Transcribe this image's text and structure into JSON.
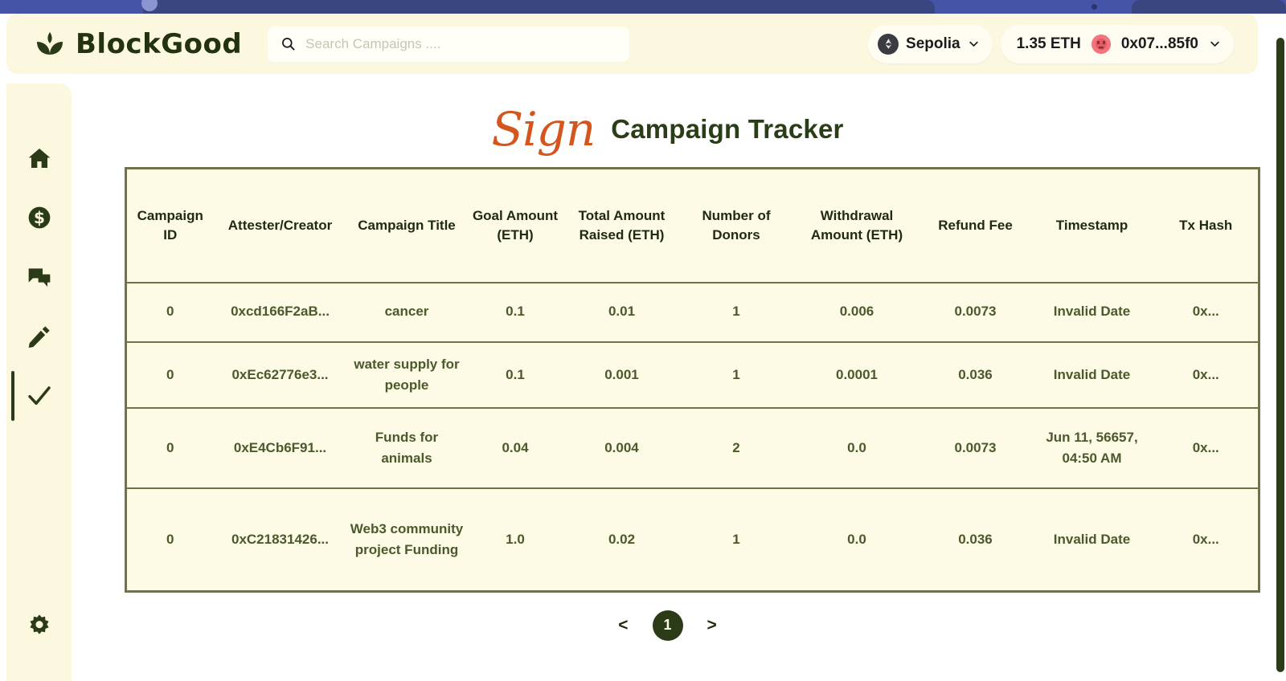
{
  "brand": {
    "name": "BlockGood",
    "logo_icon": "sprout-leaf-icon"
  },
  "search": {
    "placeholder": "Search Campaigns ....",
    "value": "",
    "icon": "search-icon"
  },
  "header": {
    "network": {
      "label": "Sepolia",
      "icon": "ethereum-icon",
      "chevron": "chevron-down-icon"
    },
    "wallet": {
      "balance": "1.35 ETH",
      "address": "0x07...85f0",
      "avatar_icon": "blockie-avatar-icon",
      "chevron": "chevron-down-icon"
    }
  },
  "sidebar": {
    "items": [
      {
        "name": "home",
        "icon": "home-icon",
        "active": false
      },
      {
        "name": "donations",
        "icon": "dollar-circle-icon",
        "active": false
      },
      {
        "name": "messages",
        "icon": "chat-bubbles-icon",
        "active": false
      },
      {
        "name": "create",
        "icon": "pencil-icon",
        "active": false
      },
      {
        "name": "verified",
        "icon": "check-icon",
        "active": true
      }
    ],
    "bottom_item": {
      "name": "settings",
      "icon": "gear-icon"
    }
  },
  "page": {
    "title_script": "Sign",
    "title": "Campaign Tracker"
  },
  "table": {
    "columns": [
      "Campaign ID",
      "Attester/Creator",
      "Campaign Title",
      "Goal Amount (ETH)",
      "Total Amount Raised (ETH)",
      "Number of Donors",
      "Withdrawal Amount (ETH)",
      "Refund Fee",
      "Timestamp",
      "Tx Hash"
    ],
    "rows": [
      {
        "campaign_id": "0",
        "attester": "0xcd166F2aB...",
        "title": "cancer",
        "goal_amount": "0.1",
        "total_raised": "0.01",
        "donors": "1",
        "withdrawal": "0.006",
        "refund_fee": "0.0073",
        "timestamp": "Invalid Date",
        "tx_hash": "0x..."
      },
      {
        "campaign_id": "0",
        "attester": "0xEc62776e3...",
        "title": "water supply for people",
        "goal_amount": "0.1",
        "total_raised": "0.001",
        "donors": "1",
        "withdrawal": "0.0001",
        "refund_fee": "0.036",
        "timestamp": "Invalid Date",
        "tx_hash": "0x..."
      },
      {
        "campaign_id": "0",
        "attester": "0xE4Cb6F91...",
        "title": "Funds for animals",
        "goal_amount": "0.04",
        "total_raised": "0.004",
        "donors": "2",
        "withdrawal": "0.0",
        "refund_fee": "0.0073",
        "timestamp": "Jun 11, 56657, 04:50 AM",
        "tx_hash": "0x..."
      },
      {
        "campaign_id": "0",
        "attester": "0xC21831426...",
        "title": "Web3 community project Funding",
        "goal_amount": "1.0",
        "total_raised": "0.02",
        "donors": "1",
        "withdrawal": "0.0",
        "refund_fee": "0.036",
        "timestamp": "Invalid Date",
        "tx_hash": "0x..."
      }
    ]
  },
  "pagination": {
    "prev_label": "<",
    "next_label": ">",
    "current_page": "1"
  },
  "colors": {
    "cream": "#fcf8e0",
    "table_bg": "#fdfae6",
    "border": "#6f7347",
    "dark_green": "#2b3a17",
    "accent_orange": "#d4561e",
    "chrome_blue": "#4654a8"
  }
}
